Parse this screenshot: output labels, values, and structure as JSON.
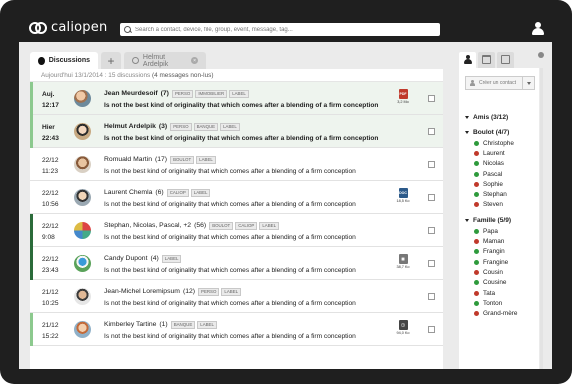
{
  "app": {
    "logo_text": "caliopen",
    "search_placeholder": "Search a contact, device, file, group, event, message, tag..."
  },
  "tabs": {
    "active_label": "Discussions",
    "plus": "+",
    "other_label": "Helmut Ardelpik",
    "other_close": "×"
  },
  "list_header": {
    "text": "Aujourd'hui 13/1/2014 : 15 discussions ",
    "unread": "(4 messages non-lus)"
  },
  "rows": [
    {
      "date1": "Auj.",
      "date2": "12:17",
      "name": "Jean Meurdesoif",
      "count": "(7)",
      "tags": [
        "PERSO",
        "IMMOBILIER",
        "LABEL"
      ],
      "snippet": "Is not the best kind of originality that which comes after a blending of a firm conception",
      "attachment": {
        "label": "PDF",
        "color": "#c0392b",
        "size": "3,2 Mo"
      },
      "unread": true,
      "bar": "light"
    },
    {
      "date1": "Hier",
      "date2": "22:43",
      "name": "Helmut Ardelpik",
      "count": "(3)",
      "tags": [
        "PERSO",
        "BANQUE",
        "LABEL"
      ],
      "snippet": "Is not the best kind of originality that which comes after a blending of a firm conception",
      "attachment": null,
      "unread": true,
      "bar": "light"
    },
    {
      "date1": "22/12",
      "date2": "11:23",
      "name": "Romuald Martin",
      "count": "(17)",
      "tags": [
        "BOULOT",
        "LABEL"
      ],
      "snippet": "Is not the best kind of originality that which comes after a blending of a firm conception",
      "attachment": null,
      "unread": false,
      "bar": "none"
    },
    {
      "date1": "22/12",
      "date2": "10:56",
      "name": "Laurent Chemla",
      "count": "(6)",
      "tags": [
        "CALIOP",
        "LABEL"
      ],
      "snippet": "Is not the best kind of originality that which comes after a blending of a firm conception",
      "attachment": {
        "label": "DOC",
        "color": "#2c5a8a",
        "size": "18,5 Ko"
      },
      "unread": false,
      "bar": "none"
    },
    {
      "date1": "22/12",
      "date2": "9:08",
      "name": "Stephan, Nicolas, Pascal, +2",
      "count": "(56)",
      "tags": [
        "BOULOT",
        "CALIOP",
        "LABEL"
      ],
      "snippet": "Is not the best kind of originality that which comes after a blending of a firm conception",
      "attachment": null,
      "unread": false,
      "bar": "dark"
    },
    {
      "date1": "22/12",
      "date2": "23:43",
      "name": "Candy Dupont",
      "count": "(4)",
      "tags": [
        "LABEL"
      ],
      "snippet": "Is not the best kind of originality that which comes after a blending of a firm conception",
      "attachment": {
        "label": "▦",
        "color": "#777777",
        "size": "38,7 Ko"
      },
      "unread": false,
      "bar": "dark"
    },
    {
      "date1": "21/12",
      "date2": "10:25",
      "name": "Jean-Michel Loremipsum",
      "count": "(12)",
      "tags": [
        "PERSO",
        "LABEL"
      ],
      "snippet": "Is not the best kind of originality that which comes after a blending of a firm conception",
      "attachment": null,
      "unread": false,
      "bar": "none"
    },
    {
      "date1": "21/12",
      "date2": "15:22",
      "name": "Kimberley Tartine",
      "count": "(1)",
      "tags": [
        "BANQUE",
        "LABEL"
      ],
      "snippet": "Is not the best kind of originality that which comes after a blending of a firm conception",
      "attachment": {
        "label": "◳",
        "color": "#444444",
        "size": "94,0 Ko"
      },
      "unread": false,
      "bar": "light"
    }
  ],
  "contacts": {
    "create_label": "Créer un contact",
    "groups": [
      {
        "title": "Amis (3/12)",
        "members": []
      },
      {
        "title": "Boulot (4/7)",
        "members": [
          {
            "name": "Christophe",
            "status": "#2e9a3c"
          },
          {
            "name": "Laurent",
            "status": "#c0392b"
          },
          {
            "name": "Nicolas",
            "status": "#2e9a3c"
          },
          {
            "name": "Pascal",
            "status": "#2e9a3c"
          },
          {
            "name": "Sophie",
            "status": "#c0392b"
          },
          {
            "name": "Stephan",
            "status": "#2e9a3c"
          },
          {
            "name": "Steven",
            "status": "#c0392b"
          }
        ]
      },
      {
        "title": "Famille (5/9)",
        "members": [
          {
            "name": "Papa",
            "status": "#2e9a3c"
          },
          {
            "name": "Maman",
            "status": "#c0392b"
          },
          {
            "name": "Frangin",
            "status": "#2e9a3c"
          },
          {
            "name": "Frangine",
            "status": "#2e9a3c"
          },
          {
            "name": "Cousin",
            "status": "#c0392b"
          },
          {
            "name": "Cousine",
            "status": "#2e9a3c"
          },
          {
            "name": "Tata",
            "status": "#c0392b"
          },
          {
            "name": "Tonton",
            "status": "#2e9a3c"
          },
          {
            "name": "Grand-mère",
            "status": "#c0392b"
          }
        ]
      }
    ]
  },
  "colors": {
    "accent_green": "#2e9a3c",
    "unread_bar": "#8cc98e",
    "dark_bar": "#2b6b3a",
    "offline_red": "#c0392b"
  }
}
